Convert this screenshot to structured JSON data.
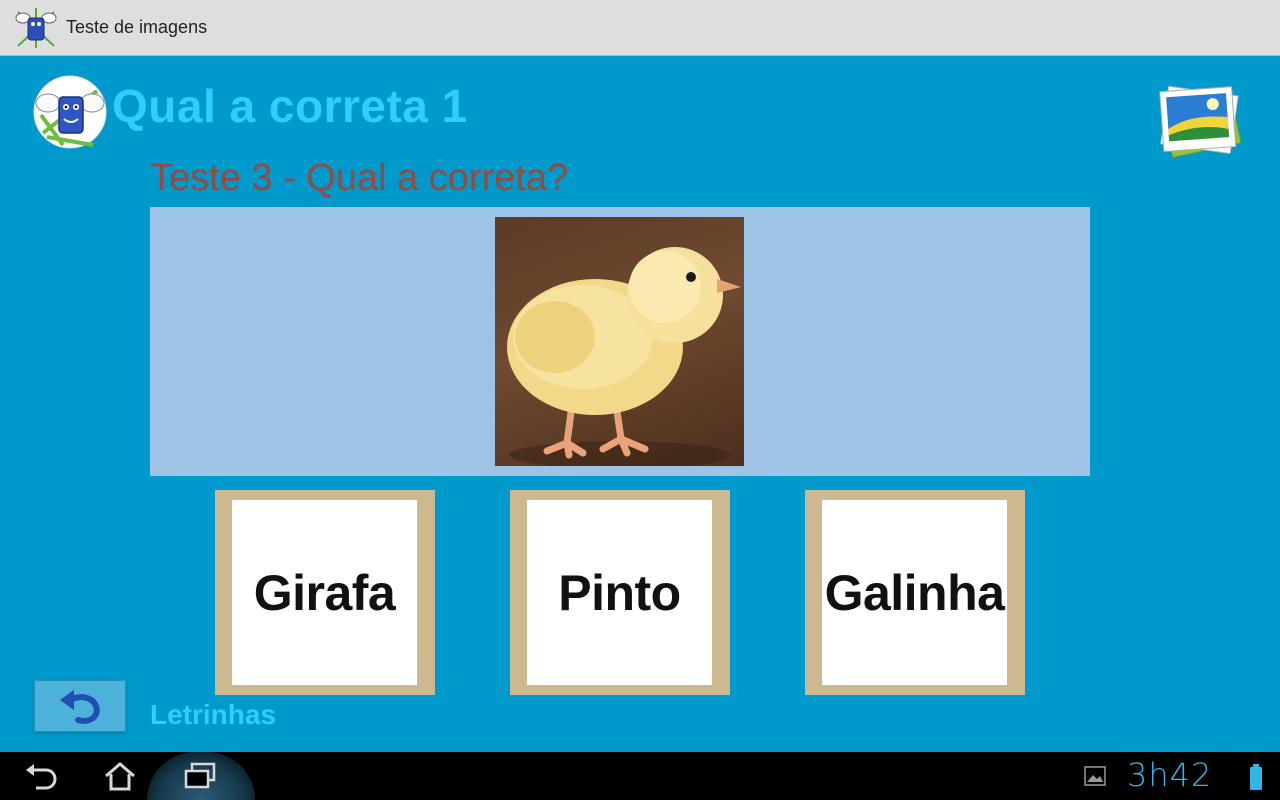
{
  "window": {
    "title": "Teste de imagens"
  },
  "header": {
    "title": "Qual a correta 1"
  },
  "question": {
    "text": "Teste 3 - Qual a correta?"
  },
  "choices": [
    {
      "label": "Girafa"
    },
    {
      "label": "Pinto"
    },
    {
      "label": "Galinha"
    }
  ],
  "footer": {
    "label": "Letrinhas"
  },
  "statusbar": {
    "clock": "3h42"
  },
  "colors": {
    "background": "#0099cc",
    "title": "#33ccff",
    "subtitle": "#9a4a3c",
    "image_panel": "#9dc3e6",
    "choice_border": "#cdb98f",
    "clock": "#33b5e5"
  },
  "icons": {
    "app": "app-mascot-icon",
    "logo": "mascot-logo-icon",
    "photos": "photo-stack-icon",
    "back": "undo-arrow-icon",
    "nav_back": "nav-back-icon",
    "nav_home": "nav-home-icon",
    "nav_recents": "nav-recents-icon",
    "gallery": "gallery-notification-icon",
    "battery": "battery-icon"
  }
}
